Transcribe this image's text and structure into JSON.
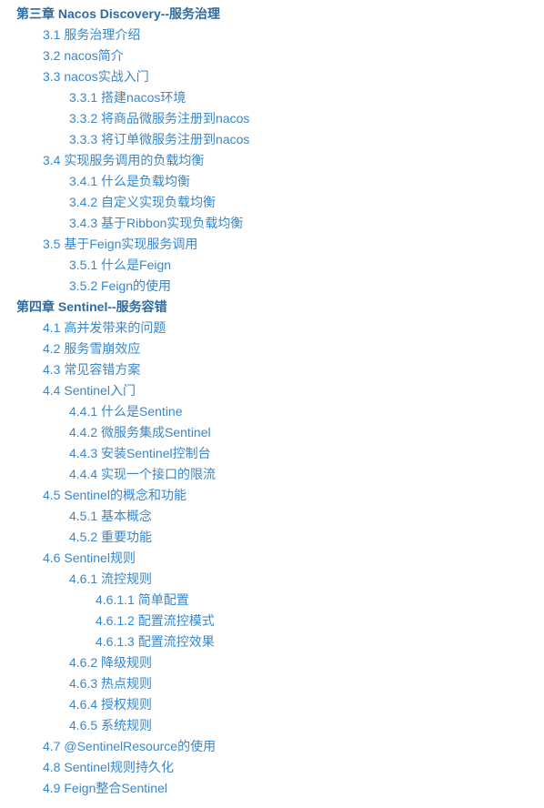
{
  "toc": [
    {
      "level": 0,
      "kind": "chapter",
      "text": "第三章 Nacos Discovery--服务治理"
    },
    {
      "level": 1,
      "kind": "link",
      "text": "3.1 服务治理介绍"
    },
    {
      "level": 1,
      "kind": "link",
      "text": "3.2 nacos简介"
    },
    {
      "level": 1,
      "kind": "link",
      "text": "3.3 nacos实战入门"
    },
    {
      "level": 2,
      "kind": "link",
      "text": "3.3.1 搭建nacos环境"
    },
    {
      "level": 2,
      "kind": "link",
      "text": "3.3.2 将商品微服务注册到nacos"
    },
    {
      "level": 2,
      "kind": "link",
      "text": "3.3.3 将订单微服务注册到nacos"
    },
    {
      "level": 1,
      "kind": "link",
      "text": "3.4 实现服务调用的负载均衡"
    },
    {
      "level": 2,
      "kind": "link",
      "text": "3.4.1 什么是负载均衡"
    },
    {
      "level": 2,
      "kind": "link",
      "text": "3.4.2 自定义实现负载均衡"
    },
    {
      "level": 2,
      "kind": "link",
      "text": "3.4.3 基于Ribbon实现负载均衡"
    },
    {
      "level": 1,
      "kind": "link",
      "text": "3.5 基于Feign实现服务调用"
    },
    {
      "level": 2,
      "kind": "link",
      "text": "3.5.1 什么是Feign"
    },
    {
      "level": 2,
      "kind": "link",
      "text": "3.5.2 Feign的使用"
    },
    {
      "level": 0,
      "kind": "chapter",
      "text": "第四章 Sentinel--服务容错"
    },
    {
      "level": 1,
      "kind": "link",
      "text": "4.1 高并发带来的问题"
    },
    {
      "level": 1,
      "kind": "link",
      "text": "4.2 服务雪崩效应"
    },
    {
      "level": 1,
      "kind": "link",
      "text": "4.3 常见容错方案"
    },
    {
      "level": 1,
      "kind": "link",
      "text": "4.4 Sentinel入门"
    },
    {
      "level": 2,
      "kind": "link",
      "text": "4.4.1 什么是Sentine"
    },
    {
      "level": 2,
      "kind": "link",
      "text": "4.4.2 微服务集成Sentinel"
    },
    {
      "level": 2,
      "kind": "link",
      "text": "4.4.3 安装Sentinel控制台"
    },
    {
      "level": 2,
      "kind": "link",
      "text": "4.4.4 实现一个接口的限流"
    },
    {
      "level": 1,
      "kind": "link",
      "text": "4.5 Sentinel的概念和功能"
    },
    {
      "level": 2,
      "kind": "link",
      "text": "4.5.1 基本概念"
    },
    {
      "level": 2,
      "kind": "link",
      "text": "4.5.2 重要功能"
    },
    {
      "level": 1,
      "kind": "link",
      "text": "4.6 Sentinel规则"
    },
    {
      "level": 2,
      "kind": "link",
      "text": "4.6.1 流控规则"
    },
    {
      "level": 3,
      "kind": "link",
      "text": "4.6.1.1 简单配置"
    },
    {
      "level": 3,
      "kind": "link",
      "text": "4.6.1.2 配置流控模式"
    },
    {
      "level": 3,
      "kind": "link",
      "text": "4.6.1.3 配置流控效果"
    },
    {
      "level": 2,
      "kind": "link",
      "text": "4.6.2 降级规则"
    },
    {
      "level": 2,
      "kind": "link",
      "text": "4.6.3 热点规则"
    },
    {
      "level": 2,
      "kind": "link",
      "text": "4.6.4 授权规则"
    },
    {
      "level": 2,
      "kind": "link",
      "text": "4.6.5 系统规则"
    },
    {
      "level": 1,
      "kind": "link",
      "text": "4.7 @SentinelResource的使用"
    },
    {
      "level": 1,
      "kind": "link",
      "text": "4.8 Sentinel规则持久化"
    },
    {
      "level": 1,
      "kind": "link",
      "text": "4.9 Feign整合Sentinel"
    }
  ]
}
